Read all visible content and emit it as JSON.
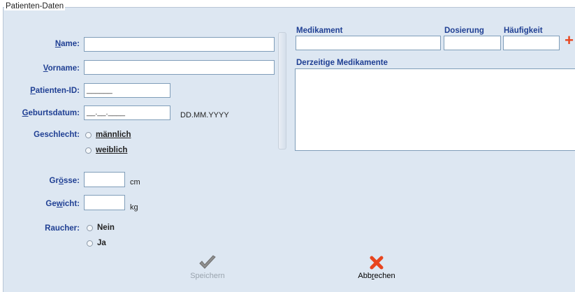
{
  "group": {
    "title": "Patienten-Daten"
  },
  "form": {
    "name": {
      "label": "Name:",
      "value": ""
    },
    "vorname": {
      "label": "Vorname:",
      "value": ""
    },
    "patient_id": {
      "label": "Patienten-ID:",
      "mask": "______"
    },
    "birthdate": {
      "label": "Geburtsdatum:",
      "mask": "__.__.____",
      "format_hint": "DD.MM.YYYY"
    },
    "gender": {
      "label": "Geschlecht:",
      "options": [
        "männlich",
        "weiblich"
      ],
      "selected": null
    },
    "height": {
      "label": "Grösse:",
      "value": "",
      "unit": "cm"
    },
    "weight": {
      "label": "Gewicht:",
      "value": "",
      "unit": "kg"
    },
    "smoker": {
      "label": "Raucher:",
      "options": [
        "Nein",
        "Ja"
      ],
      "selected": null
    }
  },
  "medication": {
    "col_medikament": "Medikament",
    "col_dosierung": "Dosierung",
    "col_haeufigkeit": "Häufigkeit",
    "add_icon": "plus-icon",
    "current_label": "Derzeitige Medikamente",
    "current_items": []
  },
  "buttons": {
    "save_label": "Speichern",
    "save_enabled": false,
    "save_icon": "checkmark-icon",
    "cancel_label": "Abbrechen",
    "cancel_icon": "close-icon"
  },
  "colors": {
    "label_blue": "#1f3f93",
    "panel_bg": "#dde7f2",
    "add_orange": "#e8451e",
    "cancel_red": "#e8451e"
  }
}
